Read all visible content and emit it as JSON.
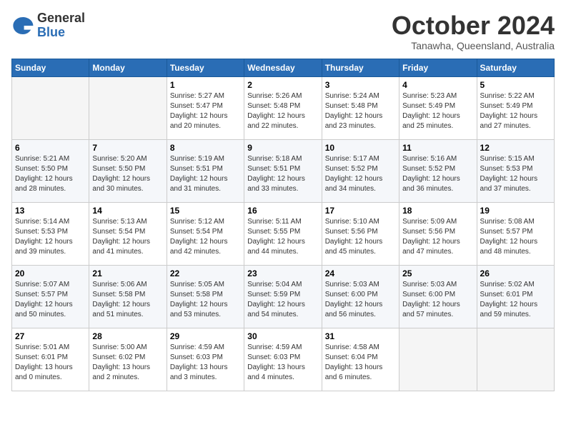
{
  "logo": {
    "general": "General",
    "blue": "Blue"
  },
  "header": {
    "month": "October 2024",
    "location": "Tanawha, Queensland, Australia"
  },
  "weekdays": [
    "Sunday",
    "Monday",
    "Tuesday",
    "Wednesday",
    "Thursday",
    "Friday",
    "Saturday"
  ],
  "weeks": [
    [
      {
        "day": "",
        "empty": true
      },
      {
        "day": "",
        "empty": true
      },
      {
        "day": "1",
        "sunrise": "Sunrise: 5:27 AM",
        "sunset": "Sunset: 5:47 PM",
        "daylight": "Daylight: 12 hours and 20 minutes."
      },
      {
        "day": "2",
        "sunrise": "Sunrise: 5:26 AM",
        "sunset": "Sunset: 5:48 PM",
        "daylight": "Daylight: 12 hours and 22 minutes."
      },
      {
        "day": "3",
        "sunrise": "Sunrise: 5:24 AM",
        "sunset": "Sunset: 5:48 PM",
        "daylight": "Daylight: 12 hours and 23 minutes."
      },
      {
        "day": "4",
        "sunrise": "Sunrise: 5:23 AM",
        "sunset": "Sunset: 5:49 PM",
        "daylight": "Daylight: 12 hours and 25 minutes."
      },
      {
        "day": "5",
        "sunrise": "Sunrise: 5:22 AM",
        "sunset": "Sunset: 5:49 PM",
        "daylight": "Daylight: 12 hours and 27 minutes."
      }
    ],
    [
      {
        "day": "6",
        "sunrise": "Sunrise: 5:21 AM",
        "sunset": "Sunset: 5:50 PM",
        "daylight": "Daylight: 12 hours and 28 minutes."
      },
      {
        "day": "7",
        "sunrise": "Sunrise: 5:20 AM",
        "sunset": "Sunset: 5:50 PM",
        "daylight": "Daylight: 12 hours and 30 minutes."
      },
      {
        "day": "8",
        "sunrise": "Sunrise: 5:19 AM",
        "sunset": "Sunset: 5:51 PM",
        "daylight": "Daylight: 12 hours and 31 minutes."
      },
      {
        "day": "9",
        "sunrise": "Sunrise: 5:18 AM",
        "sunset": "Sunset: 5:51 PM",
        "daylight": "Daylight: 12 hours and 33 minutes."
      },
      {
        "day": "10",
        "sunrise": "Sunrise: 5:17 AM",
        "sunset": "Sunset: 5:52 PM",
        "daylight": "Daylight: 12 hours and 34 minutes."
      },
      {
        "day": "11",
        "sunrise": "Sunrise: 5:16 AM",
        "sunset": "Sunset: 5:52 PM",
        "daylight": "Daylight: 12 hours and 36 minutes."
      },
      {
        "day": "12",
        "sunrise": "Sunrise: 5:15 AM",
        "sunset": "Sunset: 5:53 PM",
        "daylight": "Daylight: 12 hours and 37 minutes."
      }
    ],
    [
      {
        "day": "13",
        "sunrise": "Sunrise: 5:14 AM",
        "sunset": "Sunset: 5:53 PM",
        "daylight": "Daylight: 12 hours and 39 minutes."
      },
      {
        "day": "14",
        "sunrise": "Sunrise: 5:13 AM",
        "sunset": "Sunset: 5:54 PM",
        "daylight": "Daylight: 12 hours and 41 minutes."
      },
      {
        "day": "15",
        "sunrise": "Sunrise: 5:12 AM",
        "sunset": "Sunset: 5:54 PM",
        "daylight": "Daylight: 12 hours and 42 minutes."
      },
      {
        "day": "16",
        "sunrise": "Sunrise: 5:11 AM",
        "sunset": "Sunset: 5:55 PM",
        "daylight": "Daylight: 12 hours and 44 minutes."
      },
      {
        "day": "17",
        "sunrise": "Sunrise: 5:10 AM",
        "sunset": "Sunset: 5:56 PM",
        "daylight": "Daylight: 12 hours and 45 minutes."
      },
      {
        "day": "18",
        "sunrise": "Sunrise: 5:09 AM",
        "sunset": "Sunset: 5:56 PM",
        "daylight": "Daylight: 12 hours and 47 minutes."
      },
      {
        "day": "19",
        "sunrise": "Sunrise: 5:08 AM",
        "sunset": "Sunset: 5:57 PM",
        "daylight": "Daylight: 12 hours and 48 minutes."
      }
    ],
    [
      {
        "day": "20",
        "sunrise": "Sunrise: 5:07 AM",
        "sunset": "Sunset: 5:57 PM",
        "daylight": "Daylight: 12 hours and 50 minutes."
      },
      {
        "day": "21",
        "sunrise": "Sunrise: 5:06 AM",
        "sunset": "Sunset: 5:58 PM",
        "daylight": "Daylight: 12 hours and 51 minutes."
      },
      {
        "day": "22",
        "sunrise": "Sunrise: 5:05 AM",
        "sunset": "Sunset: 5:58 PM",
        "daylight": "Daylight: 12 hours and 53 minutes."
      },
      {
        "day": "23",
        "sunrise": "Sunrise: 5:04 AM",
        "sunset": "Sunset: 5:59 PM",
        "daylight": "Daylight: 12 hours and 54 minutes."
      },
      {
        "day": "24",
        "sunrise": "Sunrise: 5:03 AM",
        "sunset": "Sunset: 6:00 PM",
        "daylight": "Daylight: 12 hours and 56 minutes."
      },
      {
        "day": "25",
        "sunrise": "Sunrise: 5:03 AM",
        "sunset": "Sunset: 6:00 PM",
        "daylight": "Daylight: 12 hours and 57 minutes."
      },
      {
        "day": "26",
        "sunrise": "Sunrise: 5:02 AM",
        "sunset": "Sunset: 6:01 PM",
        "daylight": "Daylight: 12 hours and 59 minutes."
      }
    ],
    [
      {
        "day": "27",
        "sunrise": "Sunrise: 5:01 AM",
        "sunset": "Sunset: 6:01 PM",
        "daylight": "Daylight: 13 hours and 0 minutes."
      },
      {
        "day": "28",
        "sunrise": "Sunrise: 5:00 AM",
        "sunset": "Sunset: 6:02 PM",
        "daylight": "Daylight: 13 hours and 2 minutes."
      },
      {
        "day": "29",
        "sunrise": "Sunrise: 4:59 AM",
        "sunset": "Sunset: 6:03 PM",
        "daylight": "Daylight: 13 hours and 3 minutes."
      },
      {
        "day": "30",
        "sunrise": "Sunrise: 4:59 AM",
        "sunset": "Sunset: 6:03 PM",
        "daylight": "Daylight: 13 hours and 4 minutes."
      },
      {
        "day": "31",
        "sunrise": "Sunrise: 4:58 AM",
        "sunset": "Sunset: 6:04 PM",
        "daylight": "Daylight: 13 hours and 6 minutes."
      },
      {
        "day": "",
        "empty": true
      },
      {
        "day": "",
        "empty": true
      }
    ]
  ]
}
